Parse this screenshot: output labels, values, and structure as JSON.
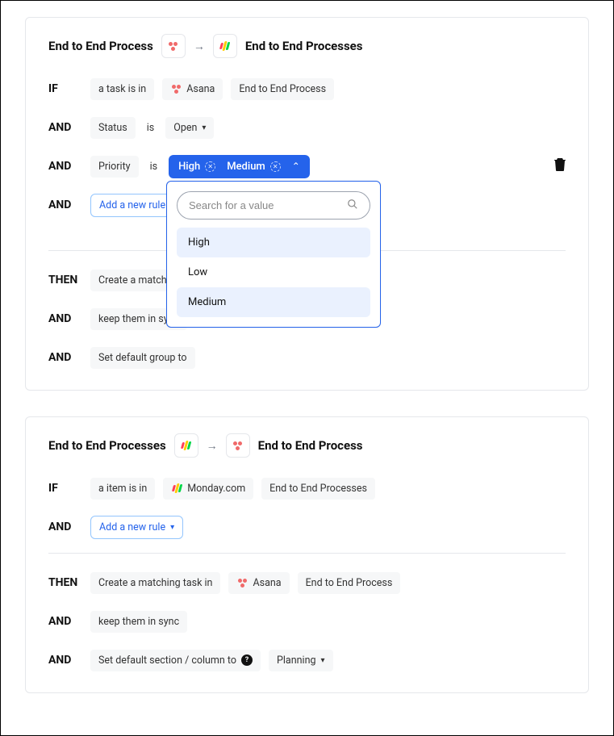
{
  "card1": {
    "title_left": "End to End Process",
    "title_right": "End to End Processes",
    "if": {
      "kw": "IF",
      "text": "a task is in",
      "app": "Asana",
      "project": "End to End Process"
    },
    "and1": {
      "kw": "AND",
      "field": "Status",
      "op": "is",
      "value": "Open"
    },
    "and2": {
      "kw": "AND",
      "field": "Priority",
      "op": "is",
      "tag1": "High",
      "tag2": "Medium"
    },
    "and3": {
      "kw": "AND",
      "add_rule": "Add a new rule"
    },
    "then": {
      "kw": "THEN",
      "action": "Create a matching"
    },
    "and4": {
      "kw": "AND",
      "action": "keep them in sync"
    },
    "and5": {
      "kw": "AND",
      "action": "Set default group to"
    },
    "dropdown": {
      "search_placeholder": "Search for a value",
      "opt1": "High",
      "opt2": "Low",
      "opt3": "Medium"
    }
  },
  "card2": {
    "title_left": "End to End Processes",
    "title_right": "End to End Process",
    "if": {
      "kw": "IF",
      "text": "a item is in",
      "app": "Monday.com",
      "project": "End to End Processes"
    },
    "and1": {
      "kw": "AND",
      "add_rule": "Add a new rule"
    },
    "then": {
      "kw": "THEN",
      "action": "Create a matching task in",
      "app": "Asana",
      "project": "End to End Process"
    },
    "and2": {
      "kw": "AND",
      "action": "keep them in sync"
    },
    "and3": {
      "kw": "AND",
      "action": "Set default section / column to",
      "value": "Planning"
    }
  }
}
